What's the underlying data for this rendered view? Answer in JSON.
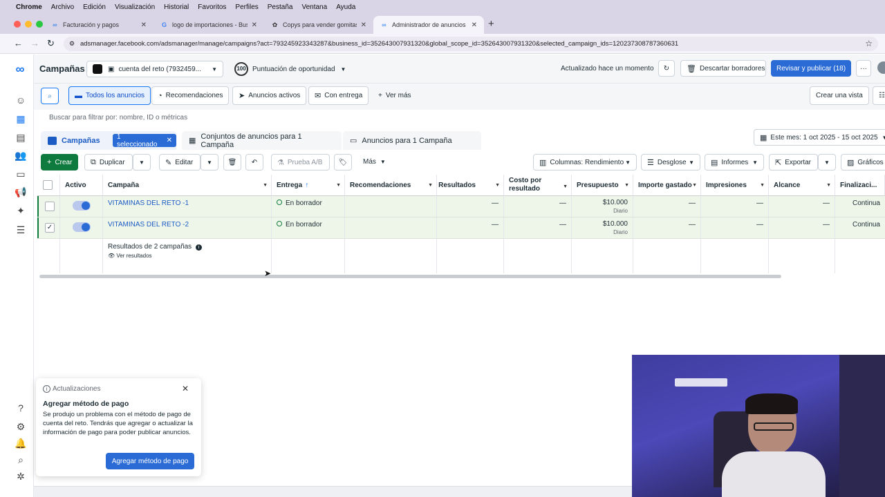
{
  "menubar": {
    "app": "Chrome",
    "items": [
      "Archivo",
      "Edición",
      "Visualización",
      "Historial",
      "Favoritos",
      "Perfiles",
      "Pestaña",
      "Ventana",
      "Ayuda"
    ]
  },
  "tabs": [
    {
      "title": "Facturación y pagos",
      "icon": "meta-icon"
    },
    {
      "title": "logo de importaciones - Busca",
      "icon": "google-icon"
    },
    {
      "title": "Copys para vender gomitas",
      "icon": "openai-icon"
    },
    {
      "title": "Administrador de anuncios -",
      "icon": "meta-icon",
      "active": true
    }
  ],
  "address": {
    "url": "adsmanager.facebook.com/adsmanager/manage/campaigns?act=793245923343287&business_id=352643007931320&global_scope_id=352643007931320&selected_campaign_ids=120237308787360631"
  },
  "header": {
    "title": "Campañas",
    "account": "cuenta del reto (7932459...",
    "score": "100",
    "score_label": "Puntuación de oportunidad",
    "updated": "Actualizado hace un momento",
    "discard": "Descartar borradores",
    "publish": "Revisar y publicar (18)"
  },
  "filters": {
    "all_ads": "Todos los anuncios",
    "recommendations": "Recomendaciones",
    "active_ads": "Anuncios activos",
    "delivery": "Con entrega",
    "more": "Ver más",
    "create_view": "Crear una vista"
  },
  "search": {
    "placeholder": "Buscar para filtrar por: nombre, ID o métricas"
  },
  "levels": {
    "campaigns": "Campañas",
    "selected": "1 seleccionado",
    "adsets": "Conjuntos de anuncios para 1 Campaña",
    "ads": "Anuncios para 1 Campaña",
    "date": "Este mes: 1 oct 2025 - 15 oct 2025"
  },
  "toolbar": {
    "create": "Crear",
    "duplicate": "Duplicar",
    "edit": "Editar",
    "abtest": "Prueba A/B",
    "more": "Más",
    "columns": "Columnas: Rendimiento",
    "breakdown": "Desglose",
    "reports": "Informes",
    "export": "Exportar",
    "charts": "Gráficos"
  },
  "table": {
    "headers": {
      "active": "Activo",
      "campaign": "Campaña",
      "delivery": "Entrega",
      "recommendations": "Recomendaciones",
      "results": "Resultados",
      "cpr1": "Costo por",
      "cpr2": "resultado",
      "budget": "Presupuesto",
      "spent": "Importe gastado",
      "impressions": "Impresiones",
      "reach": "Alcance",
      "end": "Finalizaci..."
    },
    "rows": [
      {
        "name": "VITAMINAS DEL RETO -1",
        "delivery": "En borrador",
        "results": "—",
        "cpr": "—",
        "budget": "$10.000",
        "budget_sub": "Diario",
        "spent": "—",
        "impressions": "—",
        "reach": "—",
        "end": "Continua",
        "checked": false
      },
      {
        "name": "VITAMINAS DEL RETO -2",
        "delivery": "En borrador",
        "results": "—",
        "cpr": "—",
        "budget": "$10.000",
        "budget_sub": "Diario",
        "spent": "—",
        "impressions": "—",
        "reach": "—",
        "end": "Continua",
        "checked": true
      }
    ],
    "summary": "Resultados de 2 campañas",
    "summary_link": "Ver resultados"
  },
  "popup": {
    "header": "Actualizaciones",
    "title": "Agregar método de pago",
    "body": "Se produjo un problema con el método de pago de cuenta del reto. Tendrás que agregar o actualizar la información de pago para poder publicar anuncios.",
    "button": "Agregar método de pago"
  },
  "colors": {
    "accent": "#2a6bd6",
    "create": "#0f7a3e",
    "row_bg": "#eef6ea"
  }
}
